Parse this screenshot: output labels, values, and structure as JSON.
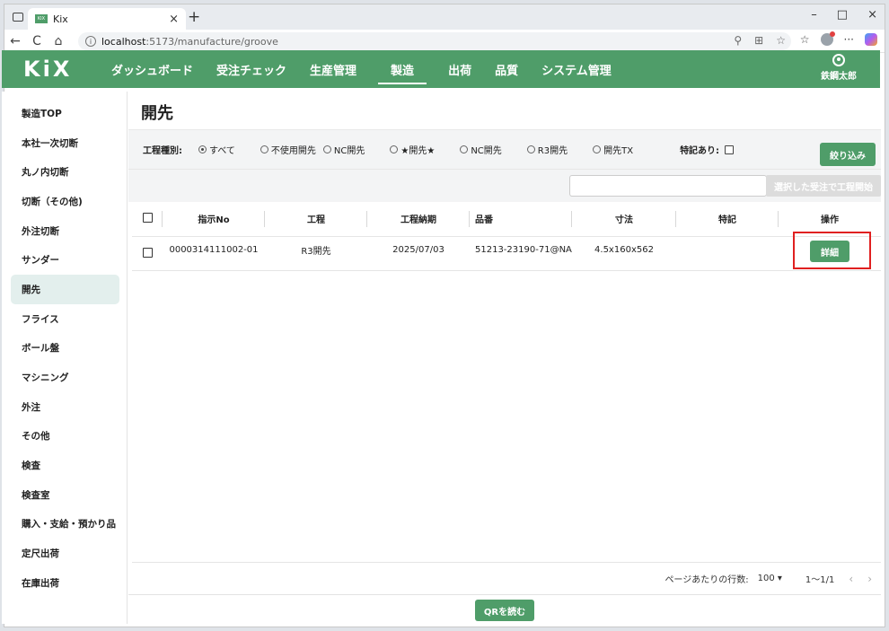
{
  "browser": {
    "tab_title": "Kix",
    "tab_close": "×",
    "tab_new": "+",
    "url_host": "localhost",
    "url_path": ":5173/manufacture/groove",
    "win_minimize": "–",
    "win_maximize": "□",
    "win_close": "×",
    "back": "←",
    "reload": "C",
    "home": "⌂"
  },
  "app": {
    "logo": "KiX",
    "nav": [
      "ダッシュボード",
      "受注チェック",
      "生産管理",
      "製造",
      "出荷",
      "品質",
      "システム管理"
    ],
    "active_nav": "製造",
    "user_name": "鉄鋼太郎",
    "brand_color": "#4f9d69"
  },
  "sidebar": {
    "items": [
      "製造TOP",
      "本社一次切断",
      "丸ノ内切断",
      "切断（その他)",
      "外注切断",
      "サンダー",
      "開先",
      "フライス",
      "ボール盤",
      "マシニング",
      "外注",
      "その他",
      "検査",
      "検査室",
      "購入・支給・預かり品",
      "定尺出荷",
      "在庫出荷"
    ],
    "active": "開先"
  },
  "main": {
    "title": "開先",
    "filter_label": "工程種別:",
    "radios": [
      "すべて",
      "不使用開先",
      "NC開先",
      "★開先★",
      "NC開先",
      "R3開先",
      "開先TX"
    ],
    "toku_label": "特記あり:",
    "narrow_button": "絞り込み",
    "start_button": "選択した受注で工程開始",
    "headers": [
      "指示No",
      "工程",
      "工程納期",
      "品番",
      "寸法",
      "特記",
      "操作"
    ],
    "rows": [
      {
        "no": "0000314111002-01",
        "process": "R3開先",
        "due": "2025/07/03",
        "part": "51213-23190-71@NA",
        "size": "4.5x160x562",
        "note": "",
        "action": "詳細"
      }
    ],
    "pager": {
      "rows_label": "ページあたりの行数:",
      "rows_value": "100 ▾",
      "range": "1〜1/1",
      "prev": "‹",
      "next": "›"
    },
    "qr_button": "QRを読む"
  }
}
